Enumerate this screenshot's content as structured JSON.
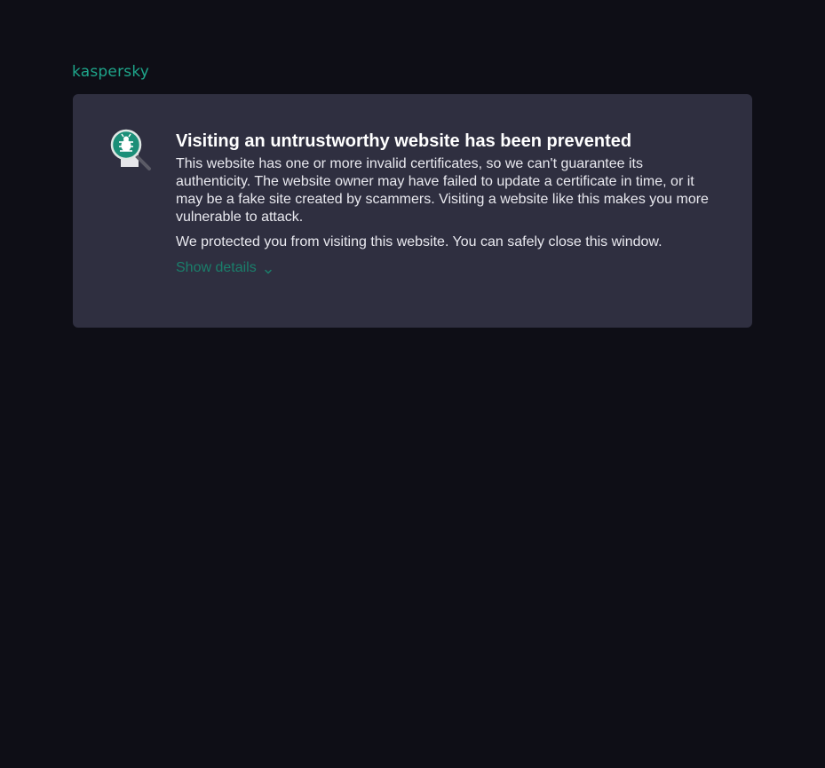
{
  "brand": {
    "name": "kaspersky",
    "accent_color": "#1ea58a"
  },
  "alert": {
    "icon": "magnifier-bug-icon",
    "title": "Visiting an untrustworthy website has been prevented",
    "description": "This website has one or more invalid certificates, so we can't guarantee its authenticity. The website owner may have failed to update a certificate in time, or it may be a fake site created by scammers. Visiting a website like this makes you more vulnerable to attack.",
    "protection_note": "We protected you from visiting this website. You can safely close this window.",
    "show_details_label": "Show details"
  }
}
